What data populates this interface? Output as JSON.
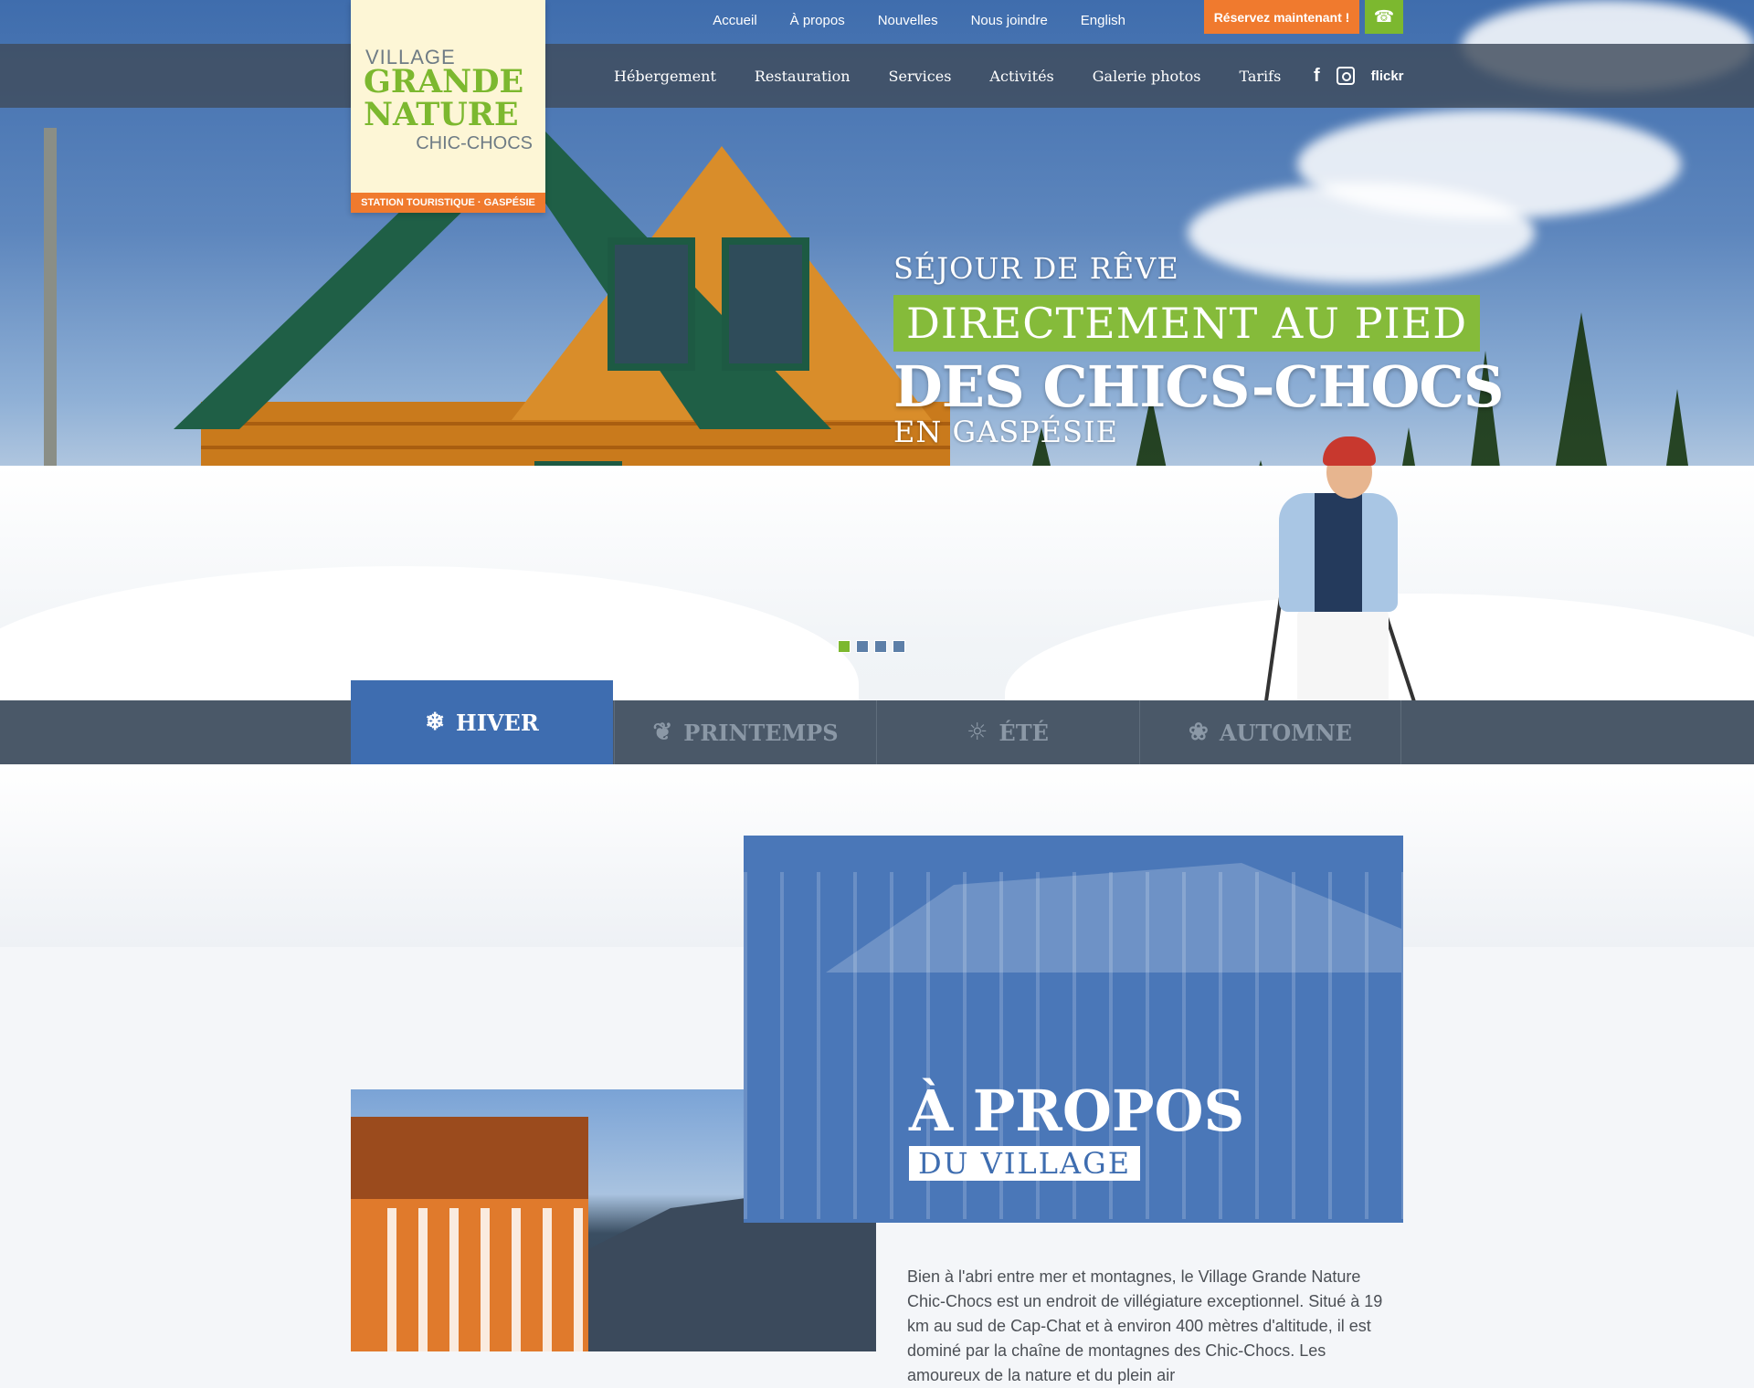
{
  "topnav": {
    "links": [
      "Accueil",
      "À propos",
      "Nouvelles",
      "Nous joindre",
      "English"
    ],
    "reserve_label": "Réservez maintenant !",
    "phone_icon": "phone-icon"
  },
  "mainnav": {
    "items": [
      "Hébergement",
      "Restauration",
      "Services",
      "Activités",
      "Galerie photos",
      "Tarifs"
    ],
    "social": {
      "facebook": "f",
      "instagram": "instagram-icon",
      "flickr": "flickr"
    }
  },
  "logo": {
    "line1": "VILLAGE",
    "line2": "GRANDE",
    "line3": "NATURE",
    "line4": "CHIC-CHOCS",
    "band": "STATION TOURISTIQUE · GASPÉSIE",
    "colors": {
      "green": "#7cb82f",
      "orange": "#f07a2e"
    }
  },
  "hero": {
    "line1": "SÉJOUR DE RÊVE",
    "line2": "DIRECTEMENT AU PIED",
    "line3": "DES CHICS-CHOCS",
    "line4": "EN GASPÉSIE",
    "slides": 4,
    "active_slide": 1
  },
  "seasons": [
    {
      "label": "HIVER",
      "icon": "snowflake-icon",
      "active": true
    },
    {
      "label": "PRINTEMPS",
      "icon": "leaf-icon",
      "active": false
    },
    {
      "label": "ÉTÉ",
      "icon": "sun-icon",
      "active": false
    },
    {
      "label": "AUTOMNE",
      "icon": "maple-leaf-icon",
      "active": false
    }
  ],
  "about": {
    "title": "À PROPOS",
    "subtitle": "DU VILLAGE",
    "text": "Bien à l'abri entre mer et montagnes, le Village Grande Nature Chic-Chocs est un endroit de villégiature exceptionnel. Situé à 19 km au sud de Cap-Chat et à environ 400 mètres d'altitude, il est dominé par la chaîne de montagnes des Chic-Chocs. Les amoureux de la nature et du plein air",
    "accent": "#3e6db0"
  }
}
